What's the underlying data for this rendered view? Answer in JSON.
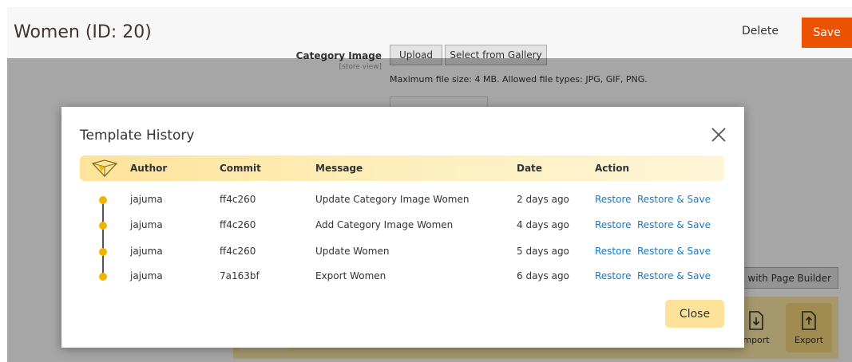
{
  "header": {
    "title": "Women (ID: 20)",
    "delete_label": "Delete",
    "save_label": "Save"
  },
  "category_image": {
    "label": "Category Image",
    "scope": "[store view]",
    "upload_label": "Upload",
    "gallery_label": "Select from Gallery",
    "note": "Maximum file size: 4 MB. Allowed file types: JPG, GIF, PNG."
  },
  "page_builder": {
    "edit_label": "t with Page Builder",
    "import_label": "mport",
    "export_label": "Export"
  },
  "modal": {
    "title": "Template History",
    "columns": {
      "author": "Author",
      "commit": "Commit",
      "message": "Message",
      "date": "Date",
      "action": "Action"
    },
    "rows": [
      {
        "author": "jajuma",
        "commit": "ff4c260",
        "message": "Update Category Image Women",
        "date": "2 days ago",
        "restore": "Restore",
        "restore_save": "Restore & Save"
      },
      {
        "author": "jajuma",
        "commit": "ff4c260",
        "message": "Add Category Image Women",
        "date": "4 days ago",
        "restore": "Restore",
        "restore_save": "Restore & Save"
      },
      {
        "author": "jajuma",
        "commit": "ff4c260",
        "message": "Update Women",
        "date": "5 days ago",
        "restore": "Restore",
        "restore_save": "Restore & Save"
      },
      {
        "author": "jajuma",
        "commit": "7a163bf",
        "message": "Export Women",
        "date": "6 days ago",
        "restore": "Restore",
        "restore_save": "Restore & Save"
      }
    ],
    "close_label": "Close"
  },
  "colors": {
    "accent": "#eb5202",
    "link": "#1979c3",
    "timeline_dot": "#f2b300",
    "header_gradient_start": "#fde39a"
  }
}
